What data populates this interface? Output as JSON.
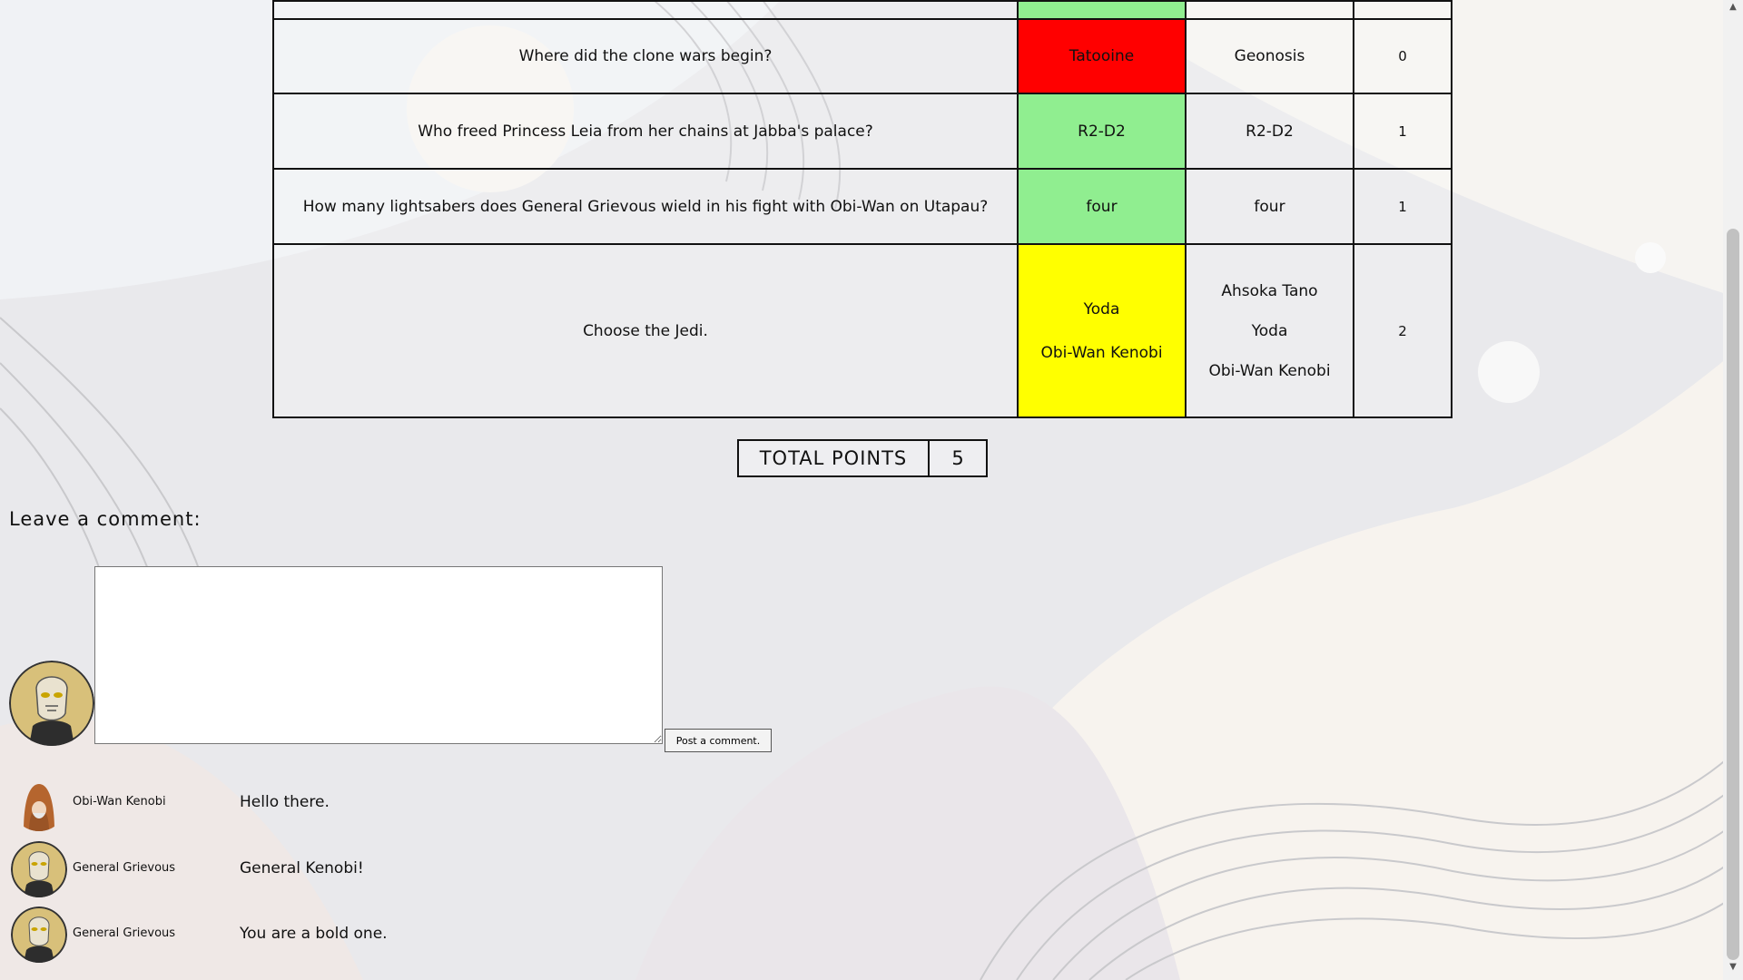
{
  "results": {
    "rows": [
      {
        "question": "Where did the clone wars begin?",
        "answers": [
          "Tatooine"
        ],
        "answer_status": "incorrect",
        "correct": [
          "Geonosis"
        ],
        "points": "0"
      },
      {
        "question": "Who freed Princess Leia from her chains at Jabba's palace?",
        "answers": [
          "R2-D2"
        ],
        "answer_status": "correct",
        "correct": [
          "R2-D2"
        ],
        "points": "1"
      },
      {
        "question": "How many lightsabers does General Grievous wield in his fight with Obi-Wan on Utapau?",
        "answers": [
          "four"
        ],
        "answer_status": "correct",
        "correct": [
          "four"
        ],
        "points": "1"
      },
      {
        "question": "Choose the Jedi.",
        "answers": [
          "Yoda",
          "Obi-Wan Kenobi"
        ],
        "answer_status": "partial",
        "correct": [
          "Ahsoka Tano",
          "Yoda",
          "Obi-Wan Kenobi"
        ],
        "points": "2"
      }
    ],
    "status_colors": {
      "correct": "#90ee90",
      "incorrect": "#ff0000",
      "partial": "#ffff00"
    }
  },
  "total": {
    "label": "TOTAL POINTS",
    "value": "5"
  },
  "comments_section": {
    "heading": "Leave a comment:",
    "input_placeholder": "",
    "input_value": "",
    "post_label": "Post a comment.",
    "current_user_avatar": "general-grievous-avatar"
  },
  "comments": [
    {
      "author": "Obi-Wan Kenobi",
      "text": "Hello there.",
      "avatar": "obi-wan-avatar"
    },
    {
      "author": "General Grievous",
      "text": "General Kenobi!",
      "avatar": "general-grievous-avatar"
    },
    {
      "author": "General Grievous",
      "text": "You are a bold one.",
      "avatar": "general-grievous-avatar"
    }
  ]
}
